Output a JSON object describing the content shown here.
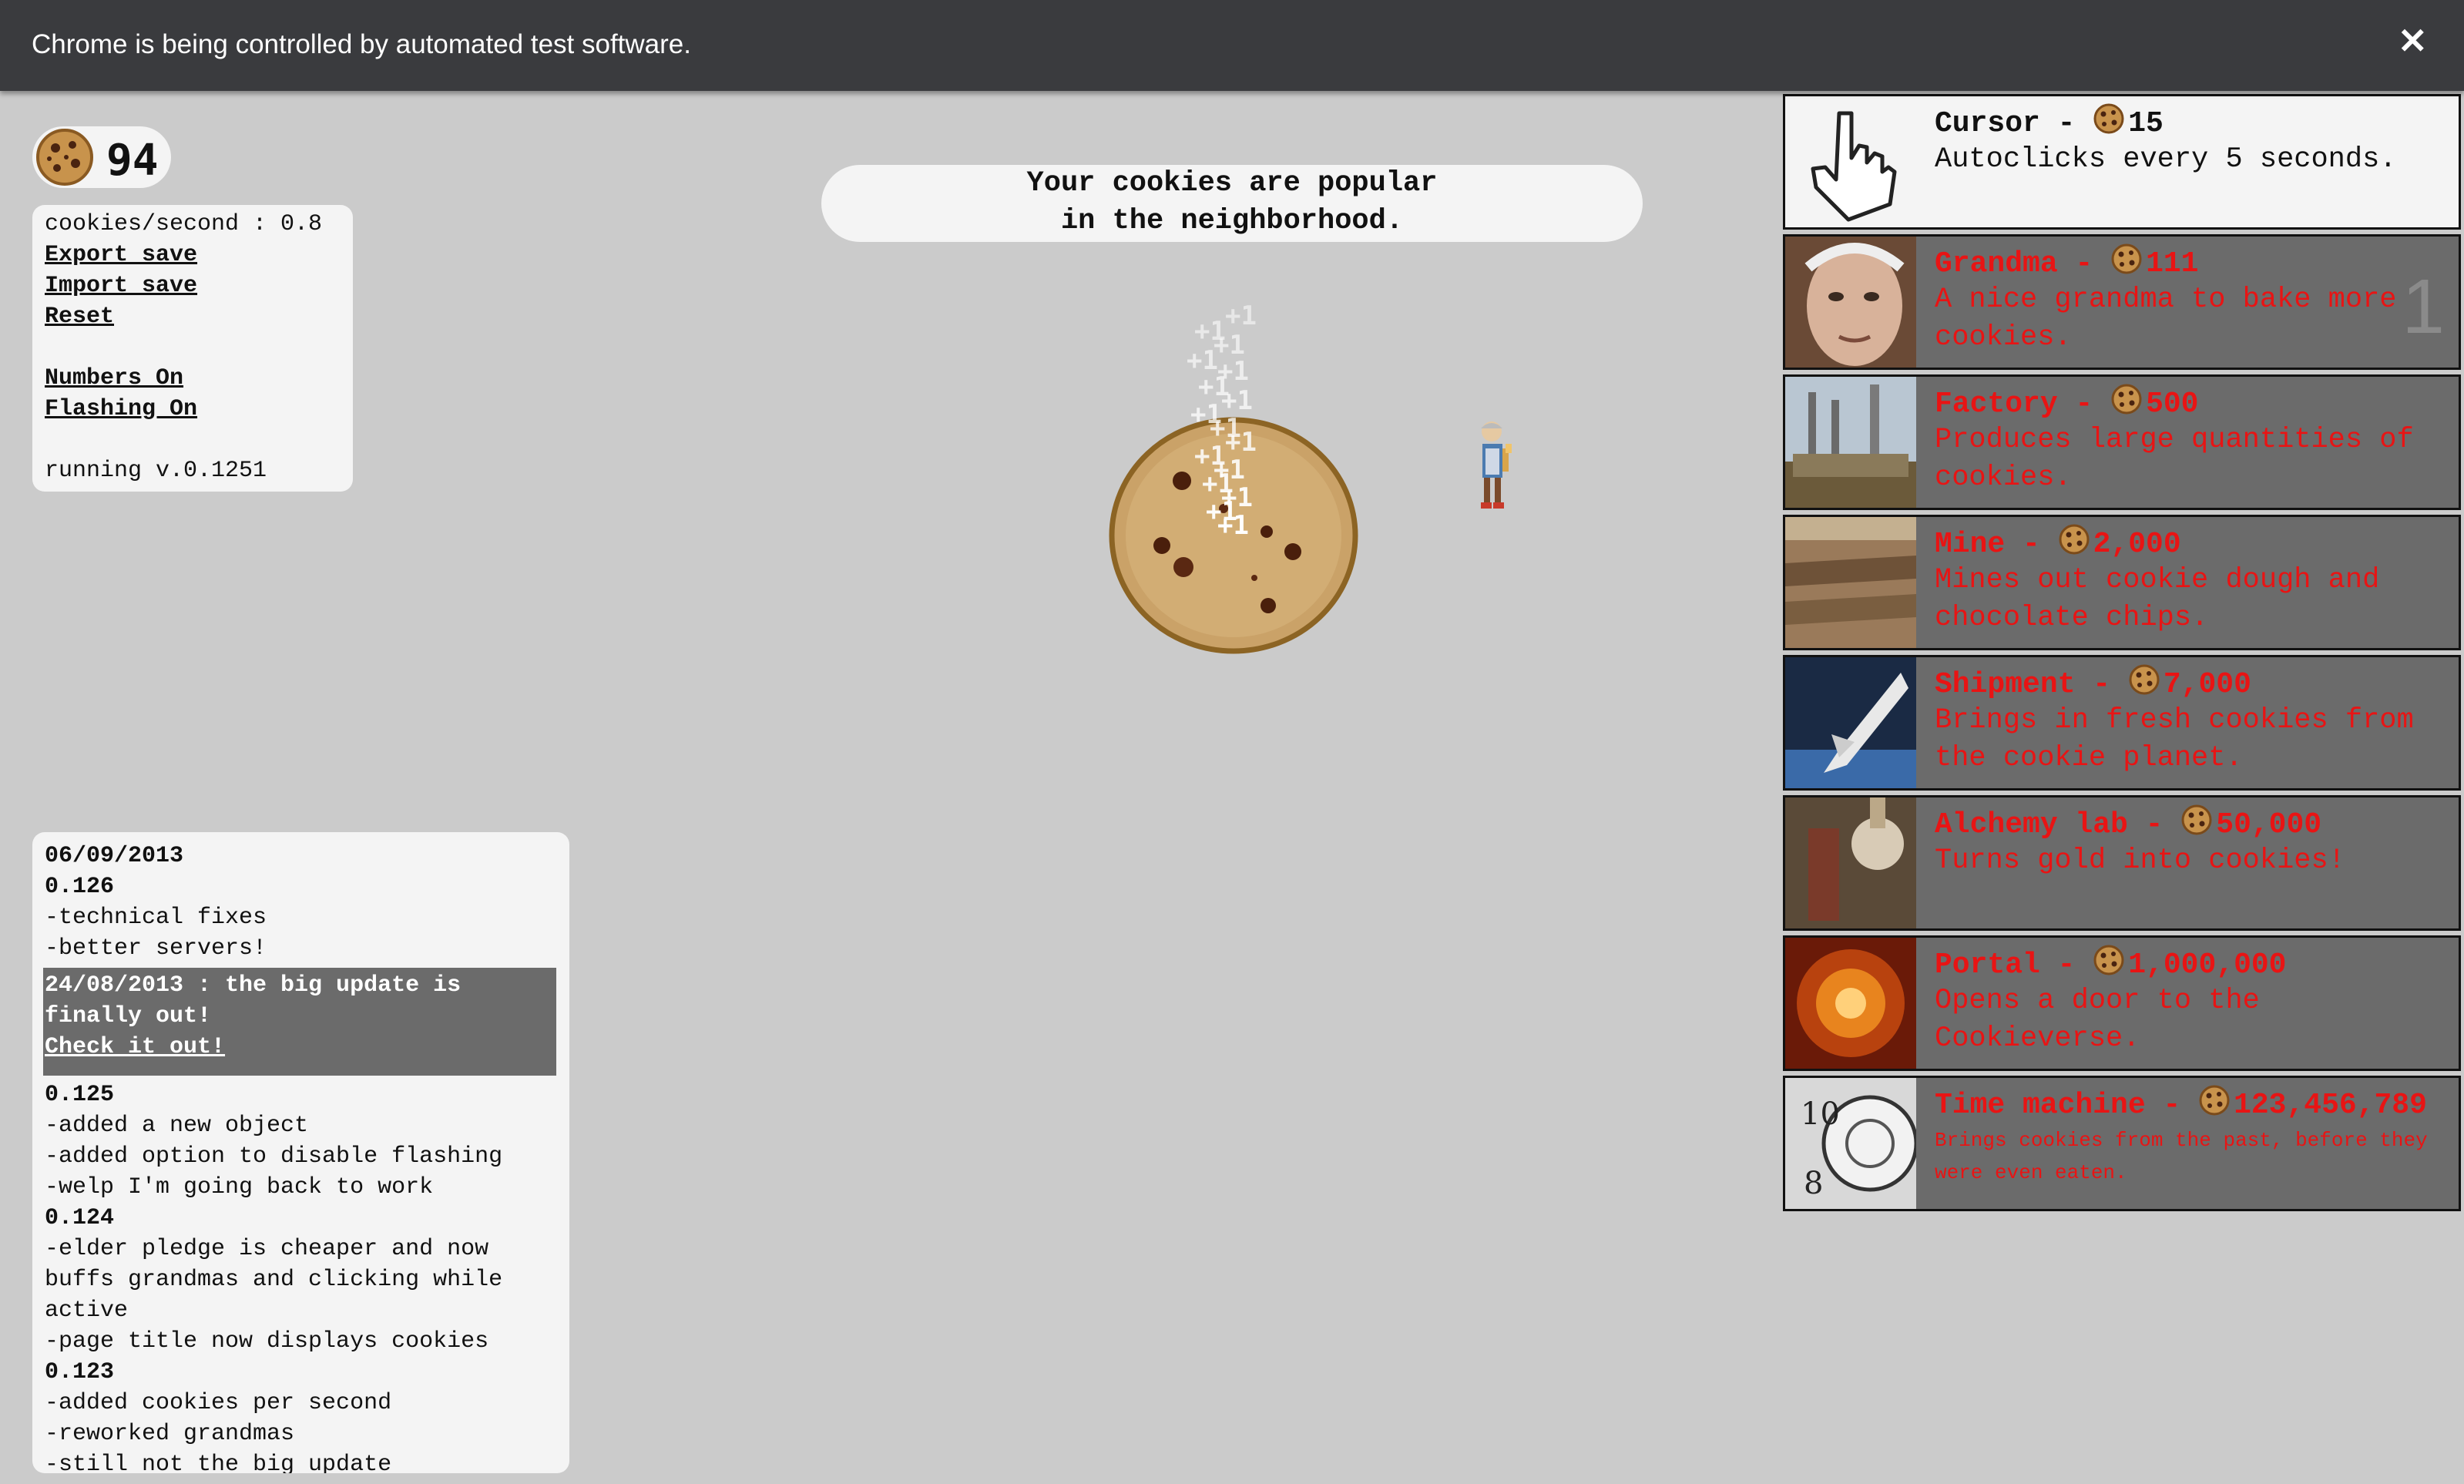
{
  "infobar": {
    "message": "Chrome is being controlled by automated test software.",
    "close": "✕"
  },
  "counter": {
    "cookies": "94"
  },
  "options": {
    "cps": "cookies/second : 0.8",
    "export_save": "Export save",
    "import_save": "Import save",
    "reset": "Reset",
    "numbers": "Numbers On",
    "flashing": "Flashing On",
    "version": "running v.0.1251"
  },
  "news": {
    "line1": "Your cookies are popular",
    "line2": "in the neighborhood."
  },
  "popups": [
    "+1",
    "+1",
    "+1",
    "+1",
    "+1",
    "+1",
    "+1",
    "+1",
    "+1",
    "+1",
    "+1",
    "+1",
    "+1",
    "+1",
    "+1",
    "+1"
  ],
  "changelog": {
    "lines": [
      {
        "text": "06/09/2013",
        "kind": "version"
      },
      {
        "text": "0.126",
        "kind": "version"
      },
      {
        "text": "-technical fixes",
        "kind": "entry"
      },
      {
        "text": "-better servers!",
        "kind": "entry"
      }
    ],
    "highlight": {
      "line1": "24/08/2013 : the big update is",
      "line2": "finally out!",
      "link": "Check it out!"
    },
    "lines2": [
      {
        "text": "0.125",
        "kind": "version"
      },
      {
        "text": "-added a new object",
        "kind": "entry"
      },
      {
        "text": "-added option to disable flashing",
        "kind": "entry"
      },
      {
        "text": "-welp I'm going back to work",
        "kind": "entry"
      },
      {
        "text": "0.124",
        "kind": "version"
      },
      {
        "text": "-elder pledge is cheaper and now",
        "kind": "entry"
      },
      {
        "text": "buffs grandmas and clicking while",
        "kind": "entry"
      },
      {
        "text": "active",
        "kind": "entry"
      },
      {
        "text": "-page title now displays cookies",
        "kind": "entry"
      },
      {
        "text": "0.123",
        "kind": "version"
      },
      {
        "text": "-added cookies per second",
        "kind": "entry"
      },
      {
        "text": "-reworked grandmas",
        "kind": "entry"
      },
      {
        "text": "-still not the big update",
        "kind": "entry"
      }
    ]
  },
  "store": {
    "items": [
      {
        "name": "Cursor",
        "sep": " - ",
        "price": "15",
        "desc": "Autoclicks every 5 seconds.",
        "affordable": true,
        "owned": "",
        "icon": "cursor-hand-icon"
      },
      {
        "name": "Grandma",
        "sep": " - ",
        "price": "111",
        "desc": "A nice grandma to bake more cookies.",
        "affordable": false,
        "owned": "1",
        "icon": "grandma-photo"
      },
      {
        "name": "Factory",
        "sep": " - ",
        "price": "500",
        "desc": "Produces large quantities of cookies.",
        "affordable": false,
        "owned": "",
        "icon": "factory-photo"
      },
      {
        "name": "Mine",
        "sep": " - ",
        "price": "2,000",
        "desc": "Mines out cookie dough and chocolate chips.",
        "affordable": false,
        "owned": "",
        "icon": "mine-photo"
      },
      {
        "name": "Shipment",
        "sep": " - ",
        "price": "7,000",
        "desc": "Brings in fresh cookies from the cookie planet.",
        "affordable": false,
        "owned": "",
        "icon": "space-shuttle-photo"
      },
      {
        "name": "Alchemy lab",
        "sep": " - ",
        "price": "50,000",
        "desc": "Turns gold into cookies!",
        "affordable": false,
        "owned": "",
        "icon": "alchemy-photo"
      },
      {
        "name": "Portal",
        "sep": " - ",
        "price": "1,000,000",
        "desc": "Opens a door to the Cookieverse.",
        "affordable": false,
        "owned": "",
        "icon": "portal-photo"
      },
      {
        "name": "Time machine",
        "sep": " - ",
        "price": "123,456,789",
        "desc": "Brings cookies from the past, before they were even eaten.",
        "affordable": false,
        "owned": "",
        "icon": "clock-photo",
        "small": true
      }
    ]
  }
}
